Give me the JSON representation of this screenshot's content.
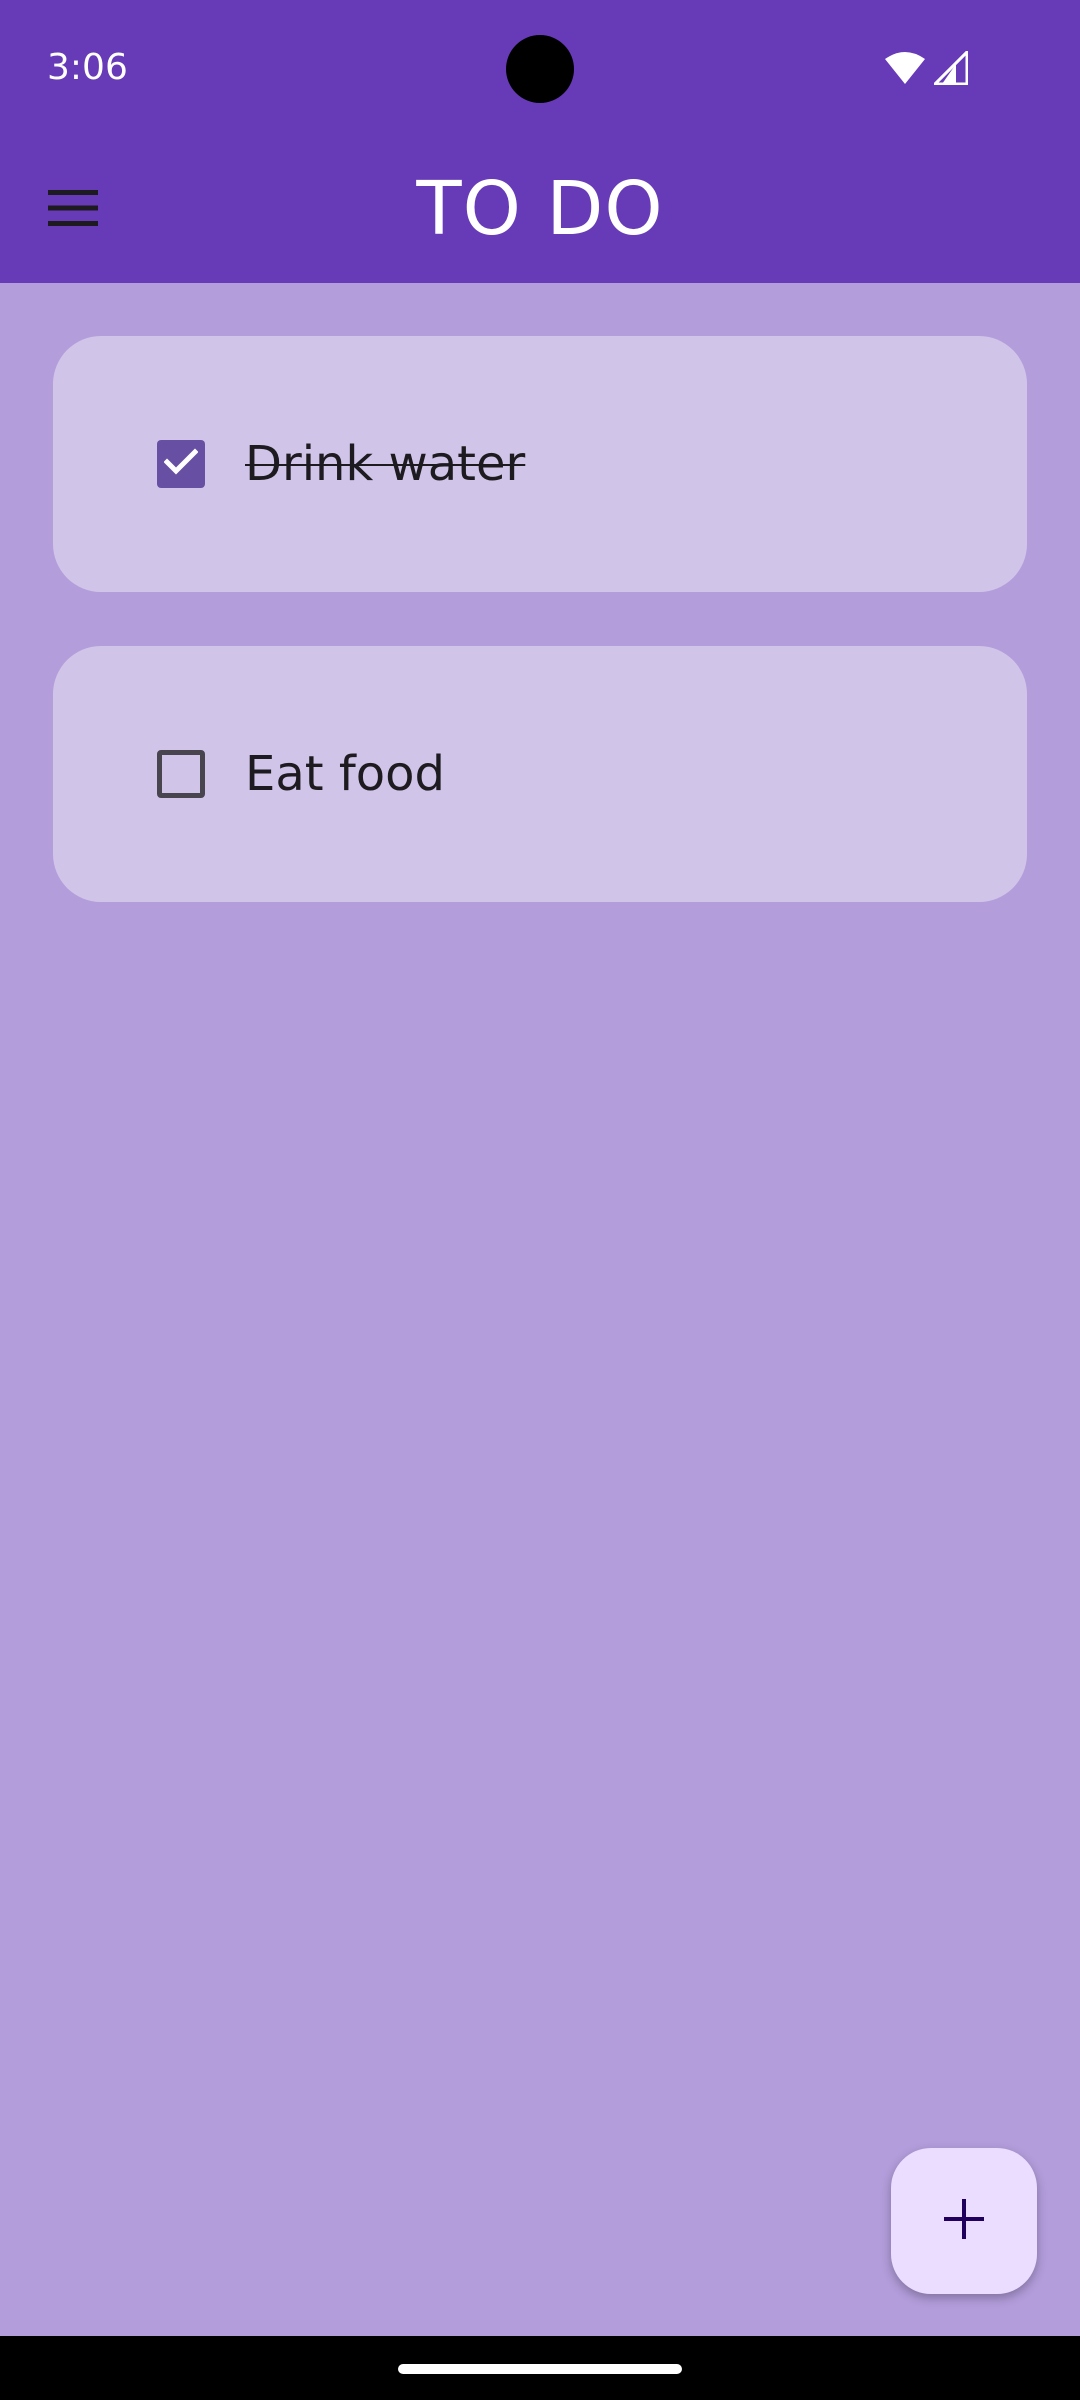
{
  "status_bar": {
    "time": "3:06",
    "icons": [
      "wifi-icon",
      "cell-signal-icon"
    ]
  },
  "app_bar": {
    "title": "TO DO",
    "menu_icon": "menu-icon"
  },
  "tasks": [
    {
      "label": "Drink water",
      "checked": true
    },
    {
      "label": "Eat food",
      "checked": false
    }
  ],
  "fab": {
    "icon": "plus-icon"
  },
  "colors": {
    "primary": "#673AB7",
    "background": "#B39DDB",
    "card": "#D1C4E9",
    "checkbox_checked": "#6750A4",
    "fab": "#EADDFF",
    "text": "#1D1B20"
  }
}
